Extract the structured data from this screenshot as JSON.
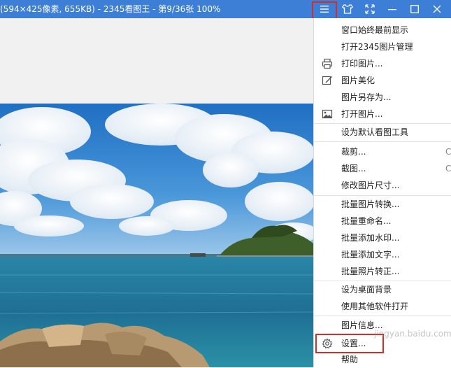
{
  "window": {
    "title": "(594×425像素, 655KB) - 2345看图王 - 第9/36张 100%"
  },
  "titlebar_buttons": [
    "menu-icon",
    "skin-icon",
    "fullscreen-icon",
    "minimize-icon",
    "maximize-icon",
    "close-icon"
  ],
  "context_menu": {
    "items": [
      {
        "label": "窗口始终最前显示"
      },
      {
        "label": "打开2345图片管理"
      },
      {
        "label": "打印图片...",
        "icon": "printer-icon"
      },
      {
        "label": "图片美化",
        "icon": "edit-icon"
      },
      {
        "label": "图片另存为..."
      },
      {
        "label": "打开图片...",
        "icon": "image-icon"
      },
      {
        "label": "设为默认看图工具"
      },
      {
        "label": "裁剪...",
        "shortcut": "Ct"
      },
      {
        "label": "截图...",
        "shortcut": "Ct"
      },
      {
        "label": "修改图片尺寸..."
      },
      {
        "label": "批量图片转换..."
      },
      {
        "label": "批量重命名..."
      },
      {
        "label": "批量添加水印..."
      },
      {
        "label": "批量添加文字..."
      },
      {
        "label": "批量照片转正..."
      },
      {
        "label": "设为桌面背景"
      },
      {
        "label": "使用其他软件打开"
      },
      {
        "label": "图片信息..."
      },
      {
        "label": "设置...",
        "icon": "gear-icon"
      },
      {
        "label": "帮助"
      }
    ]
  },
  "watermark": "jingyan.baidu.com",
  "colors": {
    "titlebar": "#3d7fd6",
    "highlight_border": "#d0302c",
    "menu_bg": "#ffffff"
  }
}
